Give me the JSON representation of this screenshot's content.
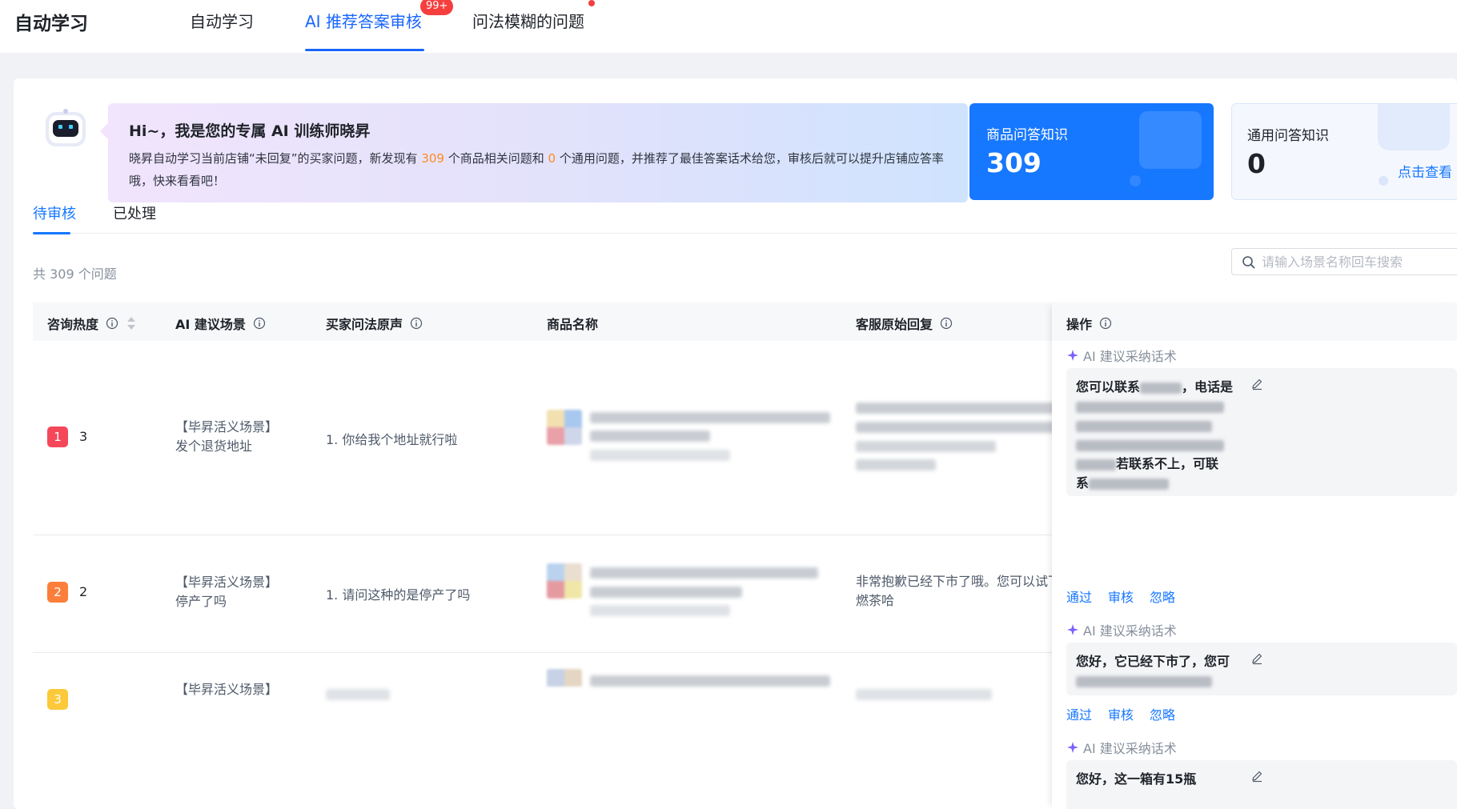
{
  "app": {
    "title": "自动学习"
  },
  "nav": {
    "tabs": [
      {
        "label": "自动学习"
      },
      {
        "label": "AI 推荐答案审核",
        "badge": "99+"
      },
      {
        "label": "问法模糊的问题"
      }
    ],
    "active_tab": "AI 推荐答案审核"
  },
  "banner": {
    "title": "Hi~，我是您的专属 AI 训练师晓昇",
    "text_1": "晓昇自动学习当前店铺“未回复”的买家问题，新发现有 ",
    "count_product": "309",
    "text_2": " 个商品相关问题和 ",
    "count_general": "0",
    "text_3": " 个通用问题，并推荐了最佳答案话术给您，审核后就可以提升店铺应答率哦，快来看看吧！"
  },
  "stats": {
    "product": {
      "label": "商品问答知识",
      "value": "309"
    },
    "general": {
      "label": "通用问答知识",
      "value": "0",
      "link": "点击查看"
    }
  },
  "subtabs": [
    {
      "label": "待审核"
    },
    {
      "label": "已处理"
    }
  ],
  "list": {
    "count_text": "共 309 个问题",
    "search_placeholder": "请输入场景名称回车搜索"
  },
  "table": {
    "headers": {
      "heat": "咨询热度",
      "scene": "AI 建议场景",
      "question": "买家问法原声",
      "product": "商品名称",
      "reply": "客服原始回复",
      "operation": "操作"
    },
    "rows": [
      {
        "rank": "1",
        "heat": "3",
        "scene_tag": "【毕昇活义场景】",
        "scene_name": "发个退货地址",
        "question": "1. 你给我个地址就行啦",
        "reply_line_1": "",
        "reply_line_2": "",
        "suggest_parts": [
          "您可以联系",
          "，电话是",
          "若联系不上，可联",
          "系"
        ],
        "actions": [
          "通过",
          "审核",
          "忽略"
        ]
      },
      {
        "rank": "2",
        "heat": "2",
        "scene_tag": "【毕昇活义场景】",
        "scene_name": "停产了吗",
        "question": "1. 请问这种的是停产了吗",
        "reply_line_1": "非常抱歉已经下市了哦。您可以试下",
        "reply_line_2": "燃茶哈",
        "suggest_parts": [
          "您好，它已经下市了，您可"
        ],
        "actions": [
          "通过",
          "审核",
          "忽略"
        ]
      },
      {
        "rank": "3",
        "heat": "",
        "scene_tag": "【毕昇活义场景】",
        "scene_name": "",
        "question": "",
        "reply_line_1": "",
        "reply_line_2": "",
        "suggest_parts": [
          "您好，这一箱有15瓶"
        ],
        "actions": []
      }
    ],
    "ai_tag": "AI 建议采纳话术"
  },
  "colors": {
    "accent": "#1677ff",
    "rank_1": "#f5475a",
    "rank_2": "#fb7f3b",
    "rank_3": "#fcc93b",
    "highlight": "#ff8a1e"
  },
  "icons": [
    "robot-avatar-icon",
    "info-icon",
    "sort-icon",
    "search-icon",
    "sparkle-icon",
    "edit-icon"
  ]
}
